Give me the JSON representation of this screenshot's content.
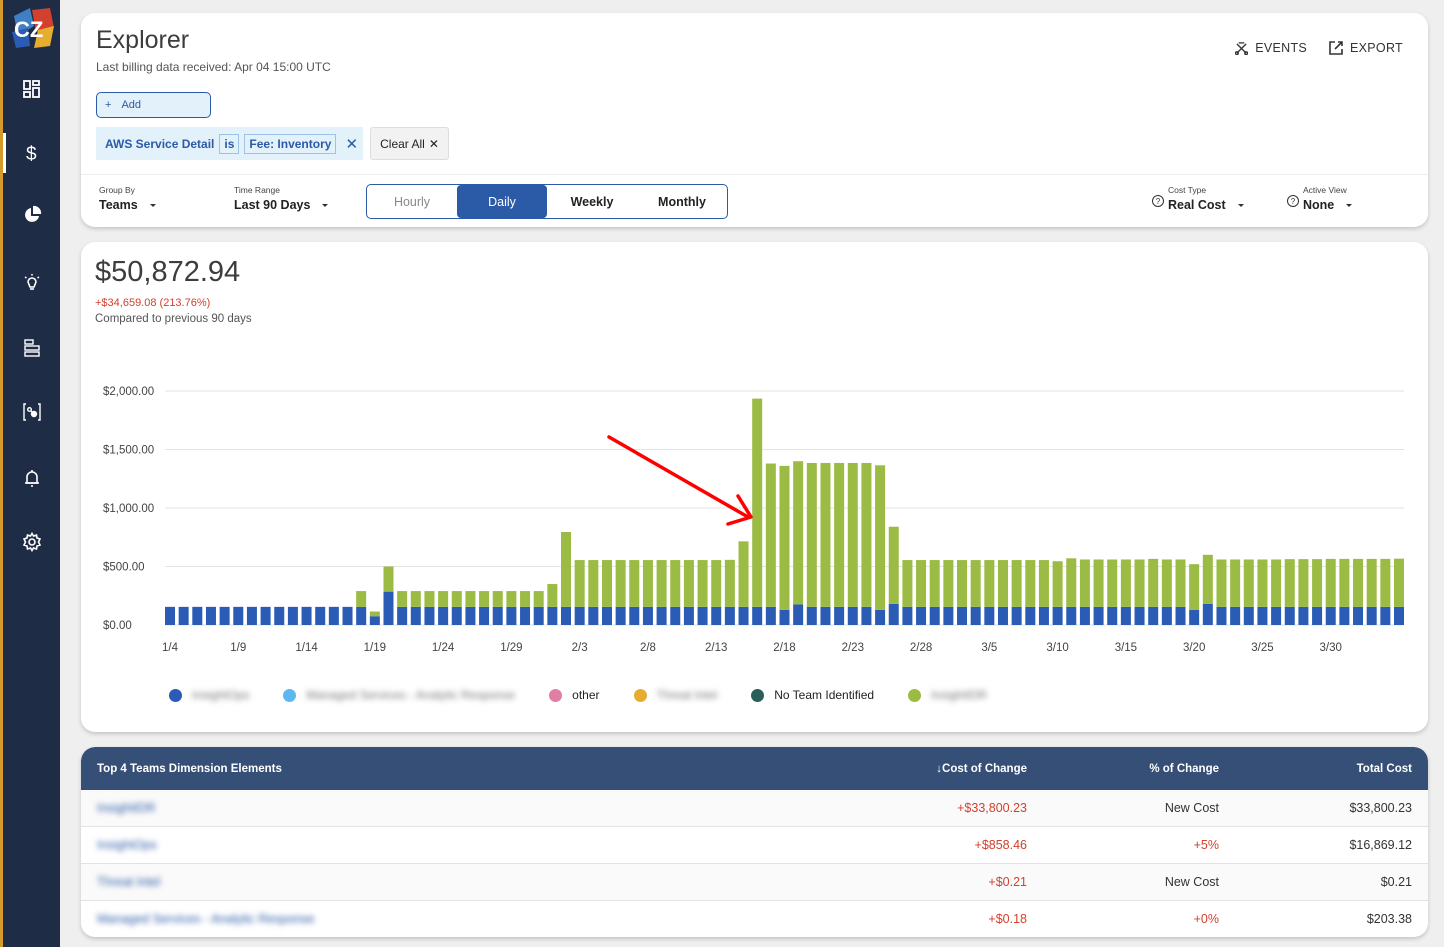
{
  "sidebar": {
    "logo_text": "CZ",
    "items": [
      {
        "name": "dashboards",
        "icon": "dashboard-icon"
      },
      {
        "name": "cost",
        "icon": "dollar-icon",
        "active": true
      },
      {
        "name": "reports",
        "icon": "pie-chart-icon"
      },
      {
        "name": "insights",
        "icon": "lightbulb-icon"
      },
      {
        "name": "allocation",
        "icon": "bars-icon"
      },
      {
        "name": "anomalies",
        "icon": "bracket-nodes-icon"
      },
      {
        "name": "alerts",
        "icon": "bell-icon"
      },
      {
        "name": "settings",
        "icon": "gear-icon"
      }
    ]
  },
  "header": {
    "title": "Explorer",
    "subtitle": "Last billing data received: Apr 04 15:00 UTC",
    "events_label": "EVENTS",
    "export_label": "EXPORT",
    "add_label": "Add",
    "filter": {
      "dimension": "AWS Service Detail",
      "operator": "is",
      "value": "Fee: Inventory"
    },
    "clear_all_label": "Clear All"
  },
  "controls": {
    "group_by": {
      "label": "Group By",
      "value": "Teams"
    },
    "time_range": {
      "label": "Time Range",
      "value": "Last 90 Days"
    },
    "granularity": [
      "Hourly",
      "Daily",
      "Weekly",
      "Monthly"
    ],
    "granularity_selected": "Daily",
    "cost_type": {
      "label": "Cost Type",
      "value": "Real Cost"
    },
    "active_view": {
      "label": "Active View",
      "value": "None"
    }
  },
  "summary": {
    "total": "$50,872.94",
    "delta": "+$34,659.08 (213.76%)",
    "compare": "Compared to previous 90 days"
  },
  "legend": [
    {
      "label": "InsightOps",
      "color": "#2a5cb5",
      "blurred": true
    },
    {
      "label": "Managed Services - Analytic Response",
      "color": "#5db8f0",
      "blurred": true
    },
    {
      "label": "other",
      "color": "#e07fa3",
      "blurred": false
    },
    {
      "label": "Threat Intel",
      "color": "#e6ad2e",
      "blurred": true
    },
    {
      "label": "No Team Identified",
      "color": "#2b5e5a",
      "blurred": false
    },
    {
      "label": "InsightIDR",
      "color": "#9bbb45",
      "blurred": true
    }
  ],
  "chart_data": {
    "type": "bar",
    "stacked": true,
    "title": "",
    "xlabel": "",
    "ylabel": "",
    "ylim": [
      0,
      2000
    ],
    "yticks": [
      "$0.00",
      "$500.00",
      "$1,000.00",
      "$1,500.00",
      "$2,000.00"
    ],
    "ytick_values": [
      0,
      500,
      1000,
      1500,
      2000
    ],
    "grid": true,
    "legend_position": "bottom",
    "xtick_labels": [
      "1/4",
      "1/9",
      "1/14",
      "1/19",
      "1/24",
      "1/29",
      "2/3",
      "2/8",
      "2/13",
      "2/18",
      "2/23",
      "2/28",
      "3/5",
      "3/10",
      "3/15",
      "3/20",
      "3/25",
      "3/30"
    ],
    "xtick_every": 5,
    "categories_start": "1/4",
    "categories_end": "4/3",
    "categories": [
      "1/4",
      "1/5",
      "1/6",
      "1/7",
      "1/8",
      "1/9",
      "1/10",
      "1/11",
      "1/12",
      "1/13",
      "1/14",
      "1/15",
      "1/16",
      "1/17",
      "1/18",
      "1/19",
      "1/20",
      "1/21",
      "1/22",
      "1/23",
      "1/24",
      "1/25",
      "1/26",
      "1/27",
      "1/28",
      "1/29",
      "1/30",
      "1/31",
      "2/1",
      "2/2",
      "2/3",
      "2/4",
      "2/5",
      "2/6",
      "2/7",
      "2/8",
      "2/9",
      "2/10",
      "2/11",
      "2/12",
      "2/13",
      "2/14",
      "2/15",
      "2/16",
      "2/17",
      "2/18",
      "2/19",
      "2/20",
      "2/21",
      "2/22",
      "2/23",
      "2/24",
      "2/25",
      "2/26",
      "2/27",
      "2/28",
      "2/29",
      "3/1",
      "3/2",
      "3/3",
      "3/4",
      "3/5",
      "3/6",
      "3/7",
      "3/8",
      "3/9",
      "3/10",
      "3/11",
      "3/12",
      "3/13",
      "3/14",
      "3/15",
      "3/16",
      "3/17",
      "3/18",
      "3/19",
      "3/20",
      "3/21",
      "3/22",
      "3/23",
      "3/24",
      "3/25",
      "3/26",
      "3/27",
      "3/28",
      "3/29",
      "3/30",
      "3/31",
      "4/1",
      "4/2",
      "4/3"
    ],
    "series": [
      {
        "name": "InsightOps",
        "color": "#2a5cb5",
        "values": [
          155,
          155,
          155,
          155,
          155,
          155,
          155,
          155,
          155,
          155,
          155,
          155,
          155,
          155,
          155,
          75,
          285,
          155,
          155,
          155,
          155,
          155,
          155,
          155,
          155,
          155,
          155,
          155,
          155,
          155,
          155,
          155,
          155,
          155,
          155,
          155,
          155,
          155,
          155,
          155,
          155,
          155,
          155,
          155,
          155,
          130,
          175,
          155,
          155,
          155,
          155,
          155,
          130,
          180,
          155,
          155,
          155,
          155,
          155,
          155,
          155,
          155,
          155,
          155,
          155,
          155,
          155,
          155,
          155,
          155,
          155,
          155,
          155,
          155,
          155,
          130,
          180,
          155,
          155,
          155,
          155,
          155,
          155,
          155,
          155,
          155,
          155,
          155,
          155,
          155,
          155
        ]
      },
      {
        "name": "InsightIDR",
        "color": "#9bbb45",
        "values": [
          0,
          0,
          0,
          0,
          0,
          0,
          0,
          0,
          0,
          0,
          0,
          0,
          0,
          0,
          135,
          40,
          215,
          135,
          135,
          135,
          135,
          135,
          135,
          135,
          135,
          135,
          135,
          135,
          195,
          640,
          400,
          400,
          400,
          400,
          400,
          400,
          400,
          400,
          400,
          400,
          400,
          402,
          560,
          1780,
          1225,
          1230,
          1225,
          1230,
          1230,
          1230,
          1230,
          1230,
          1235,
          660,
          400,
          400,
          400,
          400,
          400,
          400,
          400,
          400,
          400,
          400,
          400,
          390,
          415,
          405,
          405,
          405,
          405,
          405,
          410,
          405,
          405,
          390,
          420,
          405,
          405,
          405,
          405,
          405,
          408,
          408,
          408,
          410,
          410,
          410,
          410,
          410,
          412
        ]
      }
    ]
  },
  "table": {
    "title": "Top 4 Teams Dimension Elements",
    "columns": [
      "Cost of Change",
      "% of Change",
      "Total Cost"
    ],
    "sort_indicator": "↓",
    "rows": [
      {
        "team": "InsightIDR",
        "cost_change": "+$33,800.23",
        "pct_change": "New Cost",
        "pct_red": false,
        "total": "$33,800.23"
      },
      {
        "team": "InsightOps",
        "cost_change": "+$858.46",
        "pct_change": "+5%",
        "pct_red": true,
        "total": "$16,869.12"
      },
      {
        "team": "Threat Intel",
        "cost_change": "+$0.21",
        "pct_change": "New Cost",
        "pct_red": false,
        "total": "$0.21"
      },
      {
        "team": "Managed Services - Analytic Response",
        "cost_change": "+$0.18",
        "pct_change": "+0%",
        "pct_red": true,
        "total": "$203.38"
      }
    ]
  }
}
